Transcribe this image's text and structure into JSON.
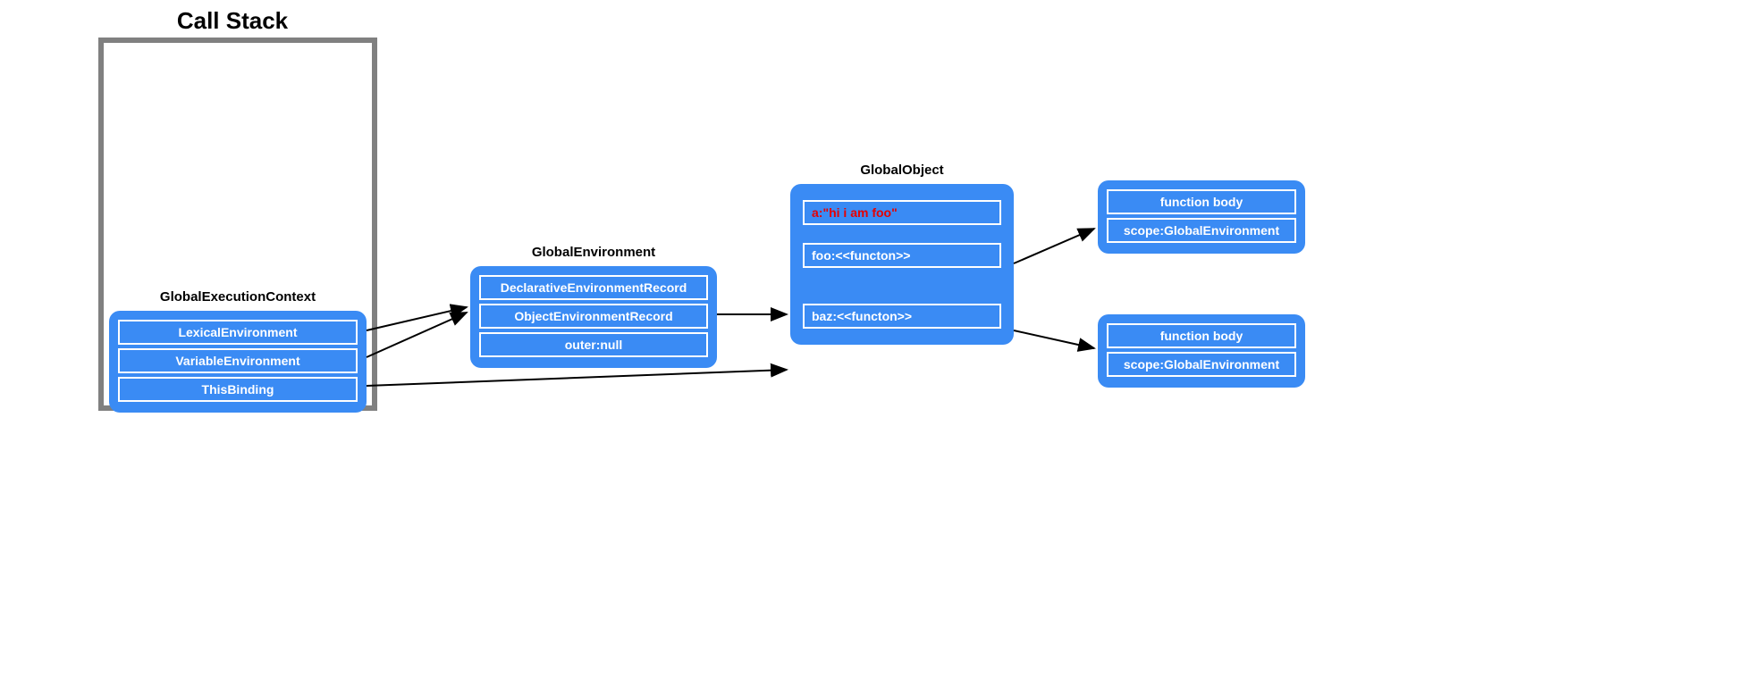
{
  "callStack": {
    "title": "Call Stack"
  },
  "gec": {
    "title": "GlobalExecutionContext",
    "rows": [
      "LexicalEnvironment",
      "VariableEnvironment",
      "ThisBinding"
    ]
  },
  "globalEnv": {
    "title": "GlobalEnvironment",
    "rows": [
      "DeclarativeEnvironmentRecord",
      "ObjectEnvironmentRecord",
      "outer:null"
    ]
  },
  "globalObj": {
    "title": "GlobalObject",
    "rows": {
      "a": "a:\"hi i am foo\"",
      "foo": "foo:<<functon>>",
      "baz": "baz:<<functon>>"
    }
  },
  "funcFoo": {
    "body": "function body",
    "scope": "scope:GlobalEnvironment"
  },
  "funcBaz": {
    "body": "function body",
    "scope": "scope:GlobalEnvironment"
  }
}
